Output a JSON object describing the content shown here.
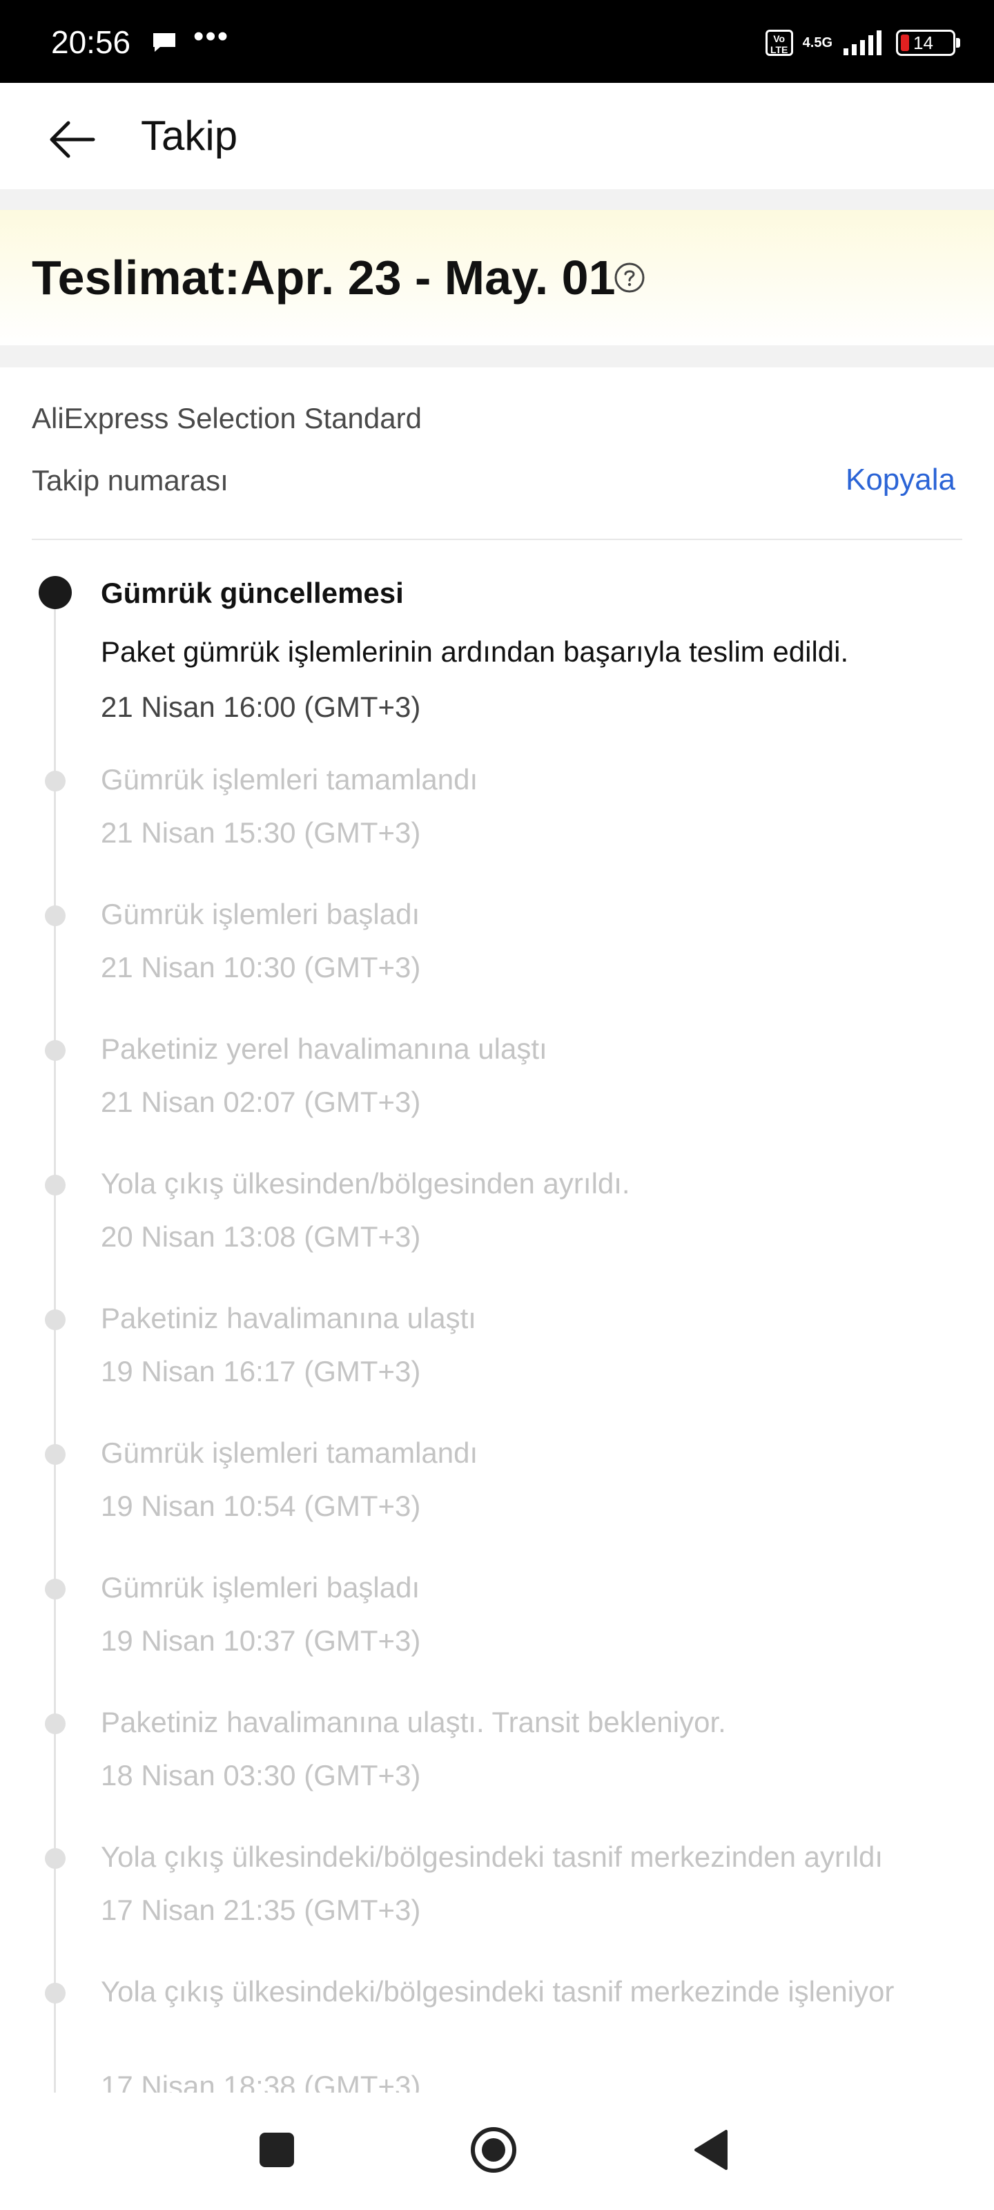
{
  "status_bar": {
    "time": "20:56",
    "more": "•••",
    "volte": "Vo LTE",
    "network": "4.5G",
    "battery": "14"
  },
  "header": {
    "title": "Takip",
    "back_icon": "back-arrow-icon"
  },
  "delivery": {
    "title": "Teslimat:Apr. 23 - May. 01",
    "help_icon": "question-circle-icon"
  },
  "shipping": {
    "carrier": "AliExpress Selection Standard",
    "tracking_label": "Takip numarası",
    "copy_label": "Kopyala"
  },
  "timeline": [
    {
      "title": "Gümrük güncellemesi",
      "desc": "Paket gümrük işlemlerinin ardından başarıyla teslim edildi.",
      "time": "21 Nisan 16:00 (GMT+3)",
      "active": true
    },
    {
      "title": "Gümrük işlemleri tamamlandı",
      "time": "21 Nisan 15:30 (GMT+3)"
    },
    {
      "title": "Gümrük işlemleri başladı",
      "time": "21 Nisan 10:30 (GMT+3)"
    },
    {
      "title": "Paketiniz yerel havalimanına ulaştı",
      "time": "21 Nisan 02:07 (GMT+3)"
    },
    {
      "title": "Yola çıkış ülkesinden/bölgesinden ayrıldı.",
      "time": "20 Nisan 13:08 (GMT+3)"
    },
    {
      "title": "Paketiniz havalimanına ulaştı",
      "time": "19 Nisan 16:17 (GMT+3)"
    },
    {
      "title": "Gümrük işlemleri tamamlandı",
      "time": "19 Nisan 10:54 (GMT+3)"
    },
    {
      "title": "Gümrük işlemleri başladı",
      "time": "19 Nisan 10:37 (GMT+3)"
    },
    {
      "title": "Paketiniz havalimanına ulaştı. Transit bekleniyor.",
      "time": "18 Nisan 03:30 (GMT+3)"
    },
    {
      "title": "Yola çıkış ülkesindeki/bölgesindeki tasnif merkezinden ayrıldı",
      "time": "17 Nisan 21:35 (GMT+3)"
    },
    {
      "title": "Yola çıkış ülkesindeki/bölgesindeki tasnif merkezinde işleniyor",
      "time": "17 Nisan 18:38 (GMT+3)"
    }
  ],
  "nav": {
    "recents_icon": "square-recents-icon",
    "home_icon": "circle-home-icon",
    "back_icon": "triangle-back-icon"
  }
}
